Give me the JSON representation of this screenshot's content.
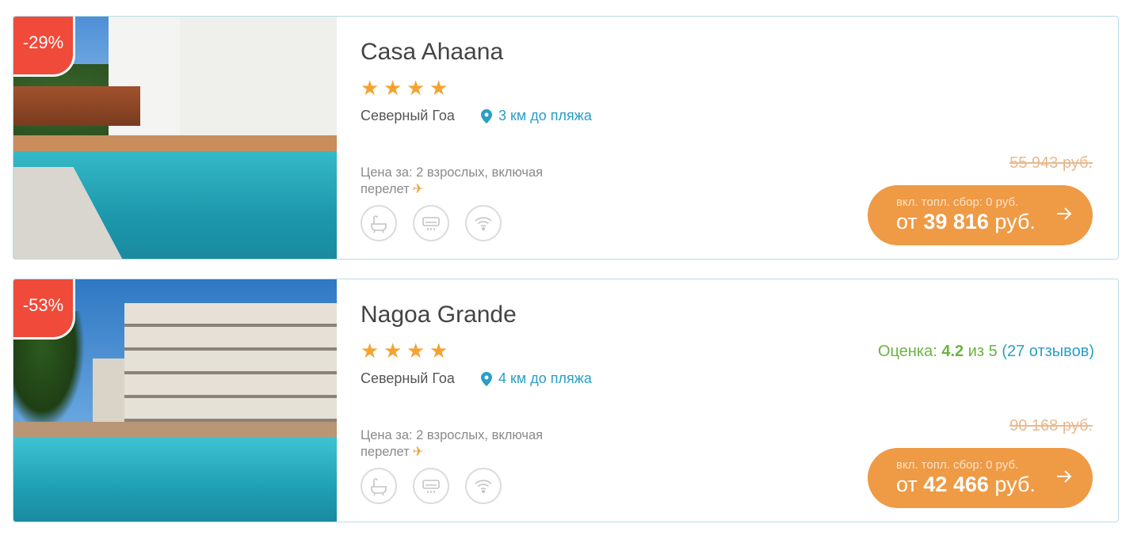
{
  "hotels": [
    {
      "discount": "-29%",
      "name": "Casa Ahaana",
      "stars": [
        "★",
        "★",
        "★",
        "★"
      ],
      "region": "Северный Гоа",
      "beach": "3 км до пляжа",
      "price_for": "Цена за: 2 взрослых, включая перелет",
      "old_price": "55 943 руб.",
      "fee": "вкл. топл. сбор: 0 руб.",
      "price_prefix": "от",
      "price_amount": "39 816",
      "price_currency": "руб."
    },
    {
      "discount": "-53%",
      "name": "Nagoa Grande",
      "stars": [
        "★",
        "★",
        "★",
        "★"
      ],
      "region": "Северный Гоа",
      "beach": "4 км до пляжа",
      "price_for": "Цена за: 2 взрослых, включая перелет",
      "rating_label": "Оценка:",
      "rating_value": "4.2",
      "rating_scale": "из 5",
      "rating_reviews": "(27 отзывов)",
      "old_price": "90 168 руб.",
      "fee": "вкл. топл. сбор: 0 руб.",
      "price_prefix": "от",
      "price_amount": "42 466",
      "price_currency": "руб."
    }
  ],
  "amenity_icons": [
    "bath-icon",
    "air-conditioner-icon",
    "wifi-icon"
  ],
  "colors": {
    "discount_badge": "#f04a3a",
    "star": "#f4a332",
    "link": "#2a9fc6",
    "rating": "#6ab440",
    "button": "#ef9a45",
    "old_price": "#eab98e",
    "card_border": "#b8dde4"
  }
}
